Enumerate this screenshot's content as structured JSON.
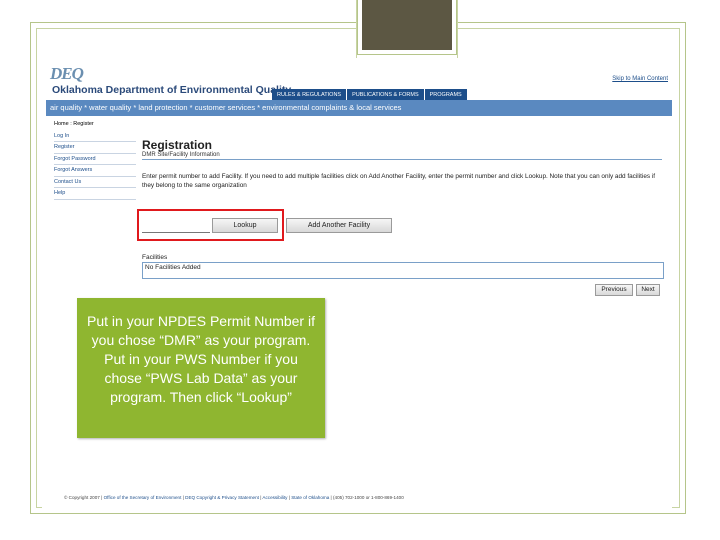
{
  "site": {
    "logo_text": "DEQ",
    "title": "Oklahoma Department of Environmental Quality",
    "skip_link": "Skip to Main Content",
    "top_tabs": [
      "Rules & Regulations",
      "Publications & Forms",
      "Programs"
    ],
    "topic_bar": "air quality * water quality * land protection * customer services * environmental complaints & local services"
  },
  "sidenav": {
    "breadcrumb": "Home : Register",
    "items": [
      "Log In",
      "Register",
      "Forgot Password",
      "Forgot Answers",
      "Contact Us",
      "Help"
    ]
  },
  "main": {
    "title": "Registration",
    "subtitle": "DMR Site/Facility Information",
    "instructions": "Enter permit number to add Facility. If you need to add multiple facilities click on Add Another Facility, enter the permit number and click Lookup. Note that you can only add facilities if they belong to the same organization",
    "permit_input_value": "",
    "lookup_label": "Lookup",
    "add_facility_label": "Add Another Facility",
    "facilities_label": "Facilities",
    "facilities_value": "No Facilities Added",
    "previous_label": "Previous",
    "next_label": "Next"
  },
  "footer": {
    "copyright": "© Copyright 2007",
    "links": [
      "Office of the Secretary of Environment",
      "DEQ Copyright & Privacy Statement",
      "Accessibility",
      "State of Oklahoma"
    ],
    "phone": "(405) 702-1000 or 1-800-869-1400"
  },
  "callout": {
    "text": "Put in your NPDES Permit Number if you chose “DMR” as your program. Put in your PWS Number if you chose “PWS Lab Data” as your program. Then click “Lookup”"
  },
  "colors": {
    "highlight": "#e0191d",
    "callout_bg": "#8fb630",
    "nav_blue": "#1d4e8a",
    "topic_bar": "#5a89c0"
  }
}
